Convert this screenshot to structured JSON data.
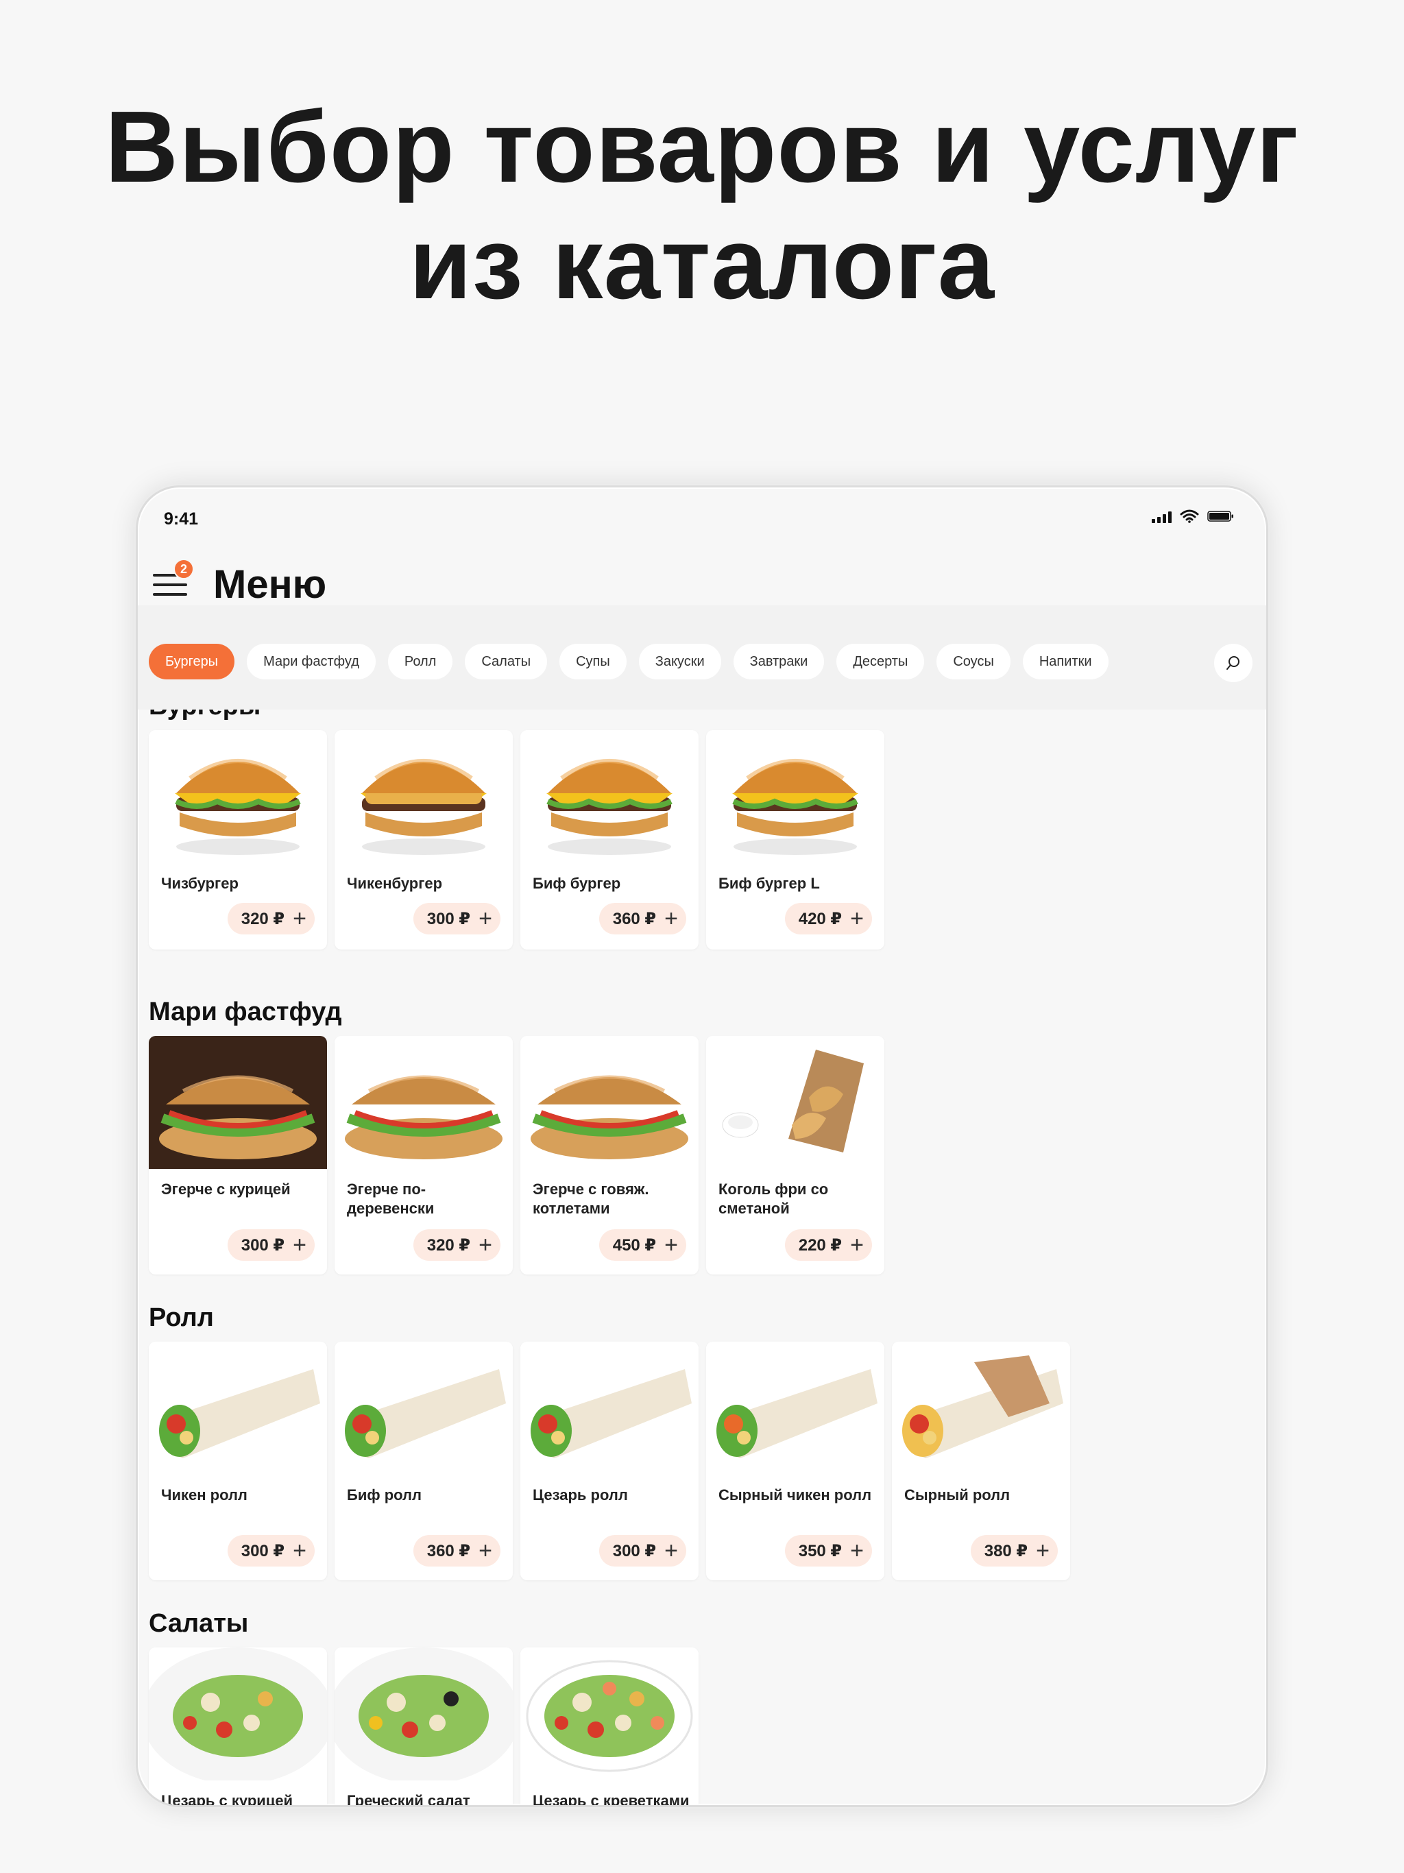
{
  "headline": {
    "line1": "Выбор товаров и услуг",
    "line2": "из каталога"
  },
  "status": {
    "time": "9:41"
  },
  "header": {
    "title": "Меню",
    "badge": "2"
  },
  "categories": [
    {
      "label": "Бургеры",
      "active": true
    },
    {
      "label": "Мари фастфуд"
    },
    {
      "label": "Ролл"
    },
    {
      "label": "Салаты"
    },
    {
      "label": "Супы"
    },
    {
      "label": "Закуски"
    },
    {
      "label": "Завтраки"
    },
    {
      "label": "Десерты"
    },
    {
      "label": "Соусы"
    },
    {
      "label": "Напитки"
    }
  ],
  "sections": [
    {
      "title": "Бургеры",
      "items": [
        {
          "name": "Чизбургер",
          "price": "320 ₽"
        },
        {
          "name": "Чикенбургер",
          "price": "300 ₽"
        },
        {
          "name": "Биф бургер",
          "price": "360 ₽"
        },
        {
          "name": "Биф бургер L",
          "price": "420 ₽"
        }
      ]
    },
    {
      "title": "Мари фастфуд",
      "items": [
        {
          "name": "Эгерче с курицей",
          "price": "300 ₽"
        },
        {
          "name": "Эгерче по-деревенски",
          "price": "320 ₽"
        },
        {
          "name": "Эгерче с говяж. котлетами",
          "price": "450 ₽"
        },
        {
          "name": "Коголь фри со сметаной",
          "price": "220 ₽"
        }
      ]
    },
    {
      "title": "Ролл",
      "items": [
        {
          "name": "Чикен ролл",
          "price": "300 ₽"
        },
        {
          "name": "Биф ролл",
          "price": "360 ₽"
        },
        {
          "name": "Цезарь ролл",
          "price": "300 ₽"
        },
        {
          "name": "Сырный чикен ролл",
          "price": "350 ₽"
        },
        {
          "name": "Сырный ролл",
          "price": "380 ₽"
        }
      ]
    },
    {
      "title": "Салаты",
      "items": [
        {
          "name": "Цезарь с курицей"
        },
        {
          "name": "Греческий салат"
        },
        {
          "name": "Цезарь с креветками"
        }
      ]
    }
  ],
  "colors": {
    "accent": "#f47038",
    "price_bg": "#fdeae2",
    "page_bg": "#f7f7f7"
  }
}
